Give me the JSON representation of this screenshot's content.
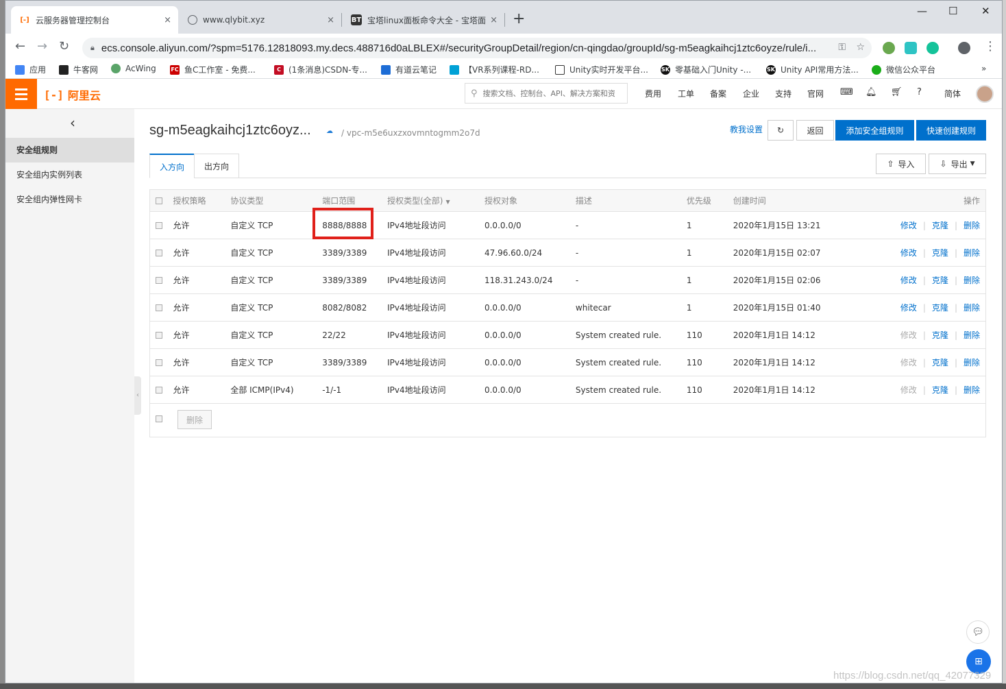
{
  "browser": {
    "tabs": [
      {
        "title": "云服务器管理控制台",
        "icon": "aliyun-icon",
        "active": true
      },
      {
        "title": "www.qlybit.xyz",
        "icon": "globe-icon",
        "active": false
      },
      {
        "title": "宝塔linux面板命令大全 - 宝塔面",
        "icon": "bt-icon",
        "icon_text": "BT",
        "active": false
      }
    ],
    "close_glyph": "×",
    "new_tab_glyph": "+",
    "url": "ecs.console.aliyun.com/?spm=5176.12818093.my.decs.488716d0aLBLEX#/securityGroupDetail/region/cn-qingdao/groupId/sg-m5eagkaihcj1ztc6oyze/rule/i...",
    "bookmarks": [
      {
        "label": "应用",
        "color": "#4285f4"
      },
      {
        "label": "牛客网",
        "color": "#222222"
      },
      {
        "label": "AcWing",
        "color": "#5aa469"
      },
      {
        "label": "鱼C工作室 - 免费...",
        "color": "#cc0000"
      },
      {
        "label": "(1条消息)CSDN-专...",
        "color": "#c30d23"
      },
      {
        "label": "有道云笔记",
        "color": "#1d6dd6"
      },
      {
        "label": "【VR系列课程-RD...",
        "color": "#00a1d6"
      },
      {
        "label": "Unity实时开发平台...",
        "color": "#333333"
      },
      {
        "label": "零基础入门Unity -...",
        "color": "#111111"
      },
      {
        "label": "Unity API常用方法...",
        "color": "#111111"
      },
      {
        "label": "微信公众平台",
        "color": "#1aad19"
      }
    ],
    "bookmarks_more": "»"
  },
  "header": {
    "logo_text": "阿里云",
    "logo_mark": "[-]",
    "search_placeholder": "搜索文档、控制台、API、解决方案和资",
    "nav": [
      "费用",
      "工单",
      "备案",
      "企业",
      "支持",
      "官网"
    ],
    "lang": "简体"
  },
  "sidebar": {
    "items": [
      {
        "label": "安全组规则",
        "active": true
      },
      {
        "label": "安全组内实例列表",
        "active": false
      },
      {
        "label": "安全组内弹性网卡",
        "active": false
      }
    ]
  },
  "page": {
    "title": "sg-m5eagkaihcj1ztc6oyz...",
    "vpc": "/ vpc-m5e6uxzxovmntogmm2o7d",
    "teach_link": "教我设置",
    "back_button": "返回",
    "add_rule_button": "添加安全组规则",
    "quick_rule_button": "快速创建规则",
    "tabs": [
      "入方向",
      "出方向"
    ],
    "import_button": "导入",
    "export_button": "导出",
    "delete_button": "删除"
  },
  "table": {
    "headers": [
      "授权策略",
      "协议类型",
      "端口范围",
      "授权类型(全部)",
      "授权对象",
      "描述",
      "优先级",
      "创建时间",
      "操作"
    ],
    "rows": [
      {
        "policy": "允许",
        "protocol": "自定义 TCP",
        "port": "8888/8888",
        "auth_type": "IPv4地址段访问",
        "object": "0.0.0.0/0",
        "desc": "-",
        "priority": "1",
        "created": "2020年1月15日 13:21",
        "edit_disabled": false
      },
      {
        "policy": "允许",
        "protocol": "自定义 TCP",
        "port": "3389/3389",
        "auth_type": "IPv4地址段访问",
        "object": "47.96.60.0/24",
        "desc": "-",
        "priority": "1",
        "created": "2020年1月15日 02:07",
        "edit_disabled": false
      },
      {
        "policy": "允许",
        "protocol": "自定义 TCP",
        "port": "3389/3389",
        "auth_type": "IPv4地址段访问",
        "object": "118.31.243.0/24",
        "desc": "-",
        "priority": "1",
        "created": "2020年1月15日 02:06",
        "edit_disabled": false
      },
      {
        "policy": "允许",
        "protocol": "自定义 TCP",
        "port": "8082/8082",
        "auth_type": "IPv4地址段访问",
        "object": "0.0.0.0/0",
        "desc": "whitecar",
        "priority": "1",
        "created": "2020年1月15日 01:40",
        "edit_disabled": false
      },
      {
        "policy": "允许",
        "protocol": "自定义 TCP",
        "port": "22/22",
        "auth_type": "IPv4地址段访问",
        "object": "0.0.0.0/0",
        "desc": "System created rule.",
        "priority": "110",
        "created": "2020年1月1日 14:12",
        "edit_disabled": true
      },
      {
        "policy": "允许",
        "protocol": "自定义 TCP",
        "port": "3389/3389",
        "auth_type": "IPv4地址段访问",
        "object": "0.0.0.0/0",
        "desc": "System created rule.",
        "priority": "110",
        "created": "2020年1月1日 14:12",
        "edit_disabled": true
      },
      {
        "policy": "允许",
        "protocol": "全部 ICMP(IPv4)",
        "port": "-1/-1",
        "auth_type": "IPv4地址段访问",
        "object": "0.0.0.0/0",
        "desc": "System created rule.",
        "priority": "110",
        "created": "2020年1月1日 14:12",
        "edit_disabled": true
      }
    ],
    "actions": {
      "edit": "修改",
      "clone": "克隆",
      "delete": "删除"
    }
  },
  "watermark": "https://blog.csdn.net/qq_42077329",
  "colors": {
    "brand": "#ff6a00",
    "primary": "#0070cc",
    "highlight": "#e0201a"
  }
}
